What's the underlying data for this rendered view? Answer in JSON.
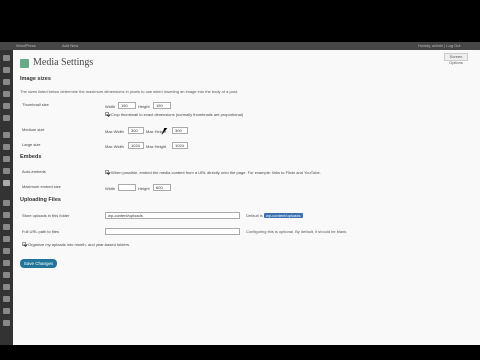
{
  "admin_bar": {
    "left_items": [
      "WordPress",
      "Add New"
    ],
    "right_text": "Howdy, admin | Log Out"
  },
  "screen_options": "Screen Options",
  "title": "Media Settings",
  "sections": {
    "image_sizes": {
      "heading": "Image sizes",
      "description": "The sizes listed below determine the maximum dimensions in pixels to use when inserting an image into the body of a post.",
      "thumbnail": {
        "label": "Thumbnail size",
        "width_label": "Width",
        "width": "150",
        "height_label": "Height",
        "height": "150",
        "crop_checked": true,
        "crop_label": "Crop thumbnail to exact dimensions (normally thumbnails are proportional)"
      },
      "medium": {
        "label": "Medium size",
        "max_width_label": "Max Width",
        "max_width": "300",
        "max_height_label": "Max Height",
        "max_height": "300"
      },
      "large": {
        "label": "Large size",
        "max_width_label": "Max Width",
        "max_width": "1024",
        "max_height_label": "Max Height",
        "max_height": "1024"
      }
    },
    "embeds": {
      "heading": "Embeds",
      "auto_embeds": {
        "label": "Auto-embeds",
        "checked": true,
        "text": "When possible, embed the media content from a URL directly onto the page. For example: links to Flickr and YouTube."
      },
      "max_size": {
        "label": "Maximum embed size",
        "width_label": "Width",
        "width": "",
        "height_label": "Height",
        "height": "600"
      }
    },
    "uploading": {
      "heading": "Uploading Files",
      "store": {
        "label": "Store uploads in this folder",
        "value": "wp-content/uploads",
        "default_text": "Default is",
        "default_value": "wp-content/uploads"
      },
      "full_url": {
        "label": "Full URL path to files",
        "value": "",
        "note": "Configuring this is optional. By default, it should be blank."
      },
      "organize": {
        "checked": true,
        "text": "Organize my uploads into month- and year-based folders"
      }
    }
  },
  "save_button": "Save Changes"
}
